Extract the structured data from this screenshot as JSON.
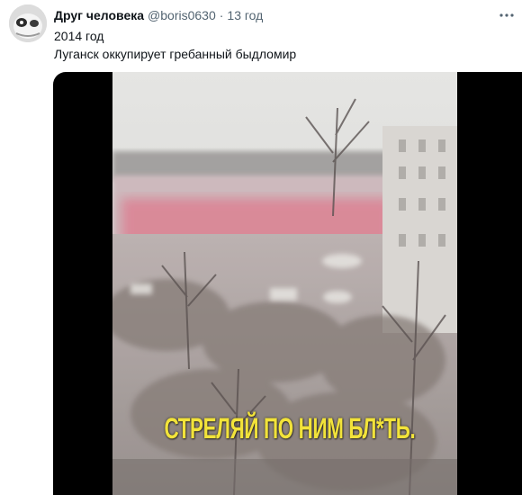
{
  "tweet": {
    "author_name": "Друг человека",
    "handle": "@boris0630",
    "separator": "·",
    "time": "13 год",
    "text_line1": "2014 год",
    "text_line2": "Луганск оккупирует гребанный быдломир"
  },
  "media": {
    "caption": "СТРЕЛЯЙ ПО НИМ БЛ*ТЬ."
  },
  "icons": {
    "avatar": "avatar",
    "more": "more-icon"
  },
  "colors": {
    "primary_text": "#0f1419",
    "secondary_text": "#536471",
    "caption": "#f2e33a",
    "media_background": "#000000"
  }
}
